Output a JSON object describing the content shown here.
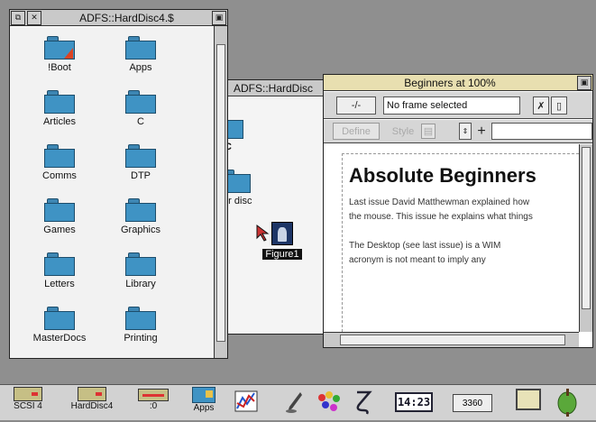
{
  "filer": {
    "title": "ADFS::HardDisc4.$",
    "items": [
      {
        "label": "!Boot"
      },
      {
        "label": "Apps"
      },
      {
        "label": "Articles"
      },
      {
        "label": "C"
      },
      {
        "label": "Comms"
      },
      {
        "label": "DTP"
      },
      {
        "label": "Games"
      },
      {
        "label": "Graphics"
      },
      {
        "label": "Letters"
      },
      {
        "label": "Library"
      },
      {
        "label": "MasterDocs"
      },
      {
        "label": "Printing"
      }
    ]
  },
  "filer2": {
    "title": "ADFS::HardDisc",
    "items": [
      {
        "label": "C"
      },
      {
        "label": "ver disc"
      }
    ],
    "file_label": "Figure1"
  },
  "editor": {
    "title": "Beginners at 100%",
    "toolbar": {
      "nav_label": "-/-",
      "frame_status": "No frame selected",
      "define_label": "Define",
      "style_label": "Style",
      "plus_label": "+"
    },
    "document": {
      "heading": "Absolute Beginners",
      "lines": [
        "Last issue David Matthewman explained how",
        "the mouse. This issue he explains what things",
        "",
        "The Desktop (see last issue) is a WIM",
        "acronym is not meant to imply any"
      ]
    }
  },
  "iconbar": {
    "drives": [
      {
        "label": "SCSI 4"
      },
      {
        "label": "HardDisc4"
      },
      {
        "label": ":0"
      },
      {
        "label": "Apps"
      }
    ],
    "clock": "14:23",
    "memory": "3360"
  },
  "colors": {
    "folder": "#3f93c4",
    "desktop": "#8f8f8f",
    "titlebar_active": "#e8dfb0"
  }
}
